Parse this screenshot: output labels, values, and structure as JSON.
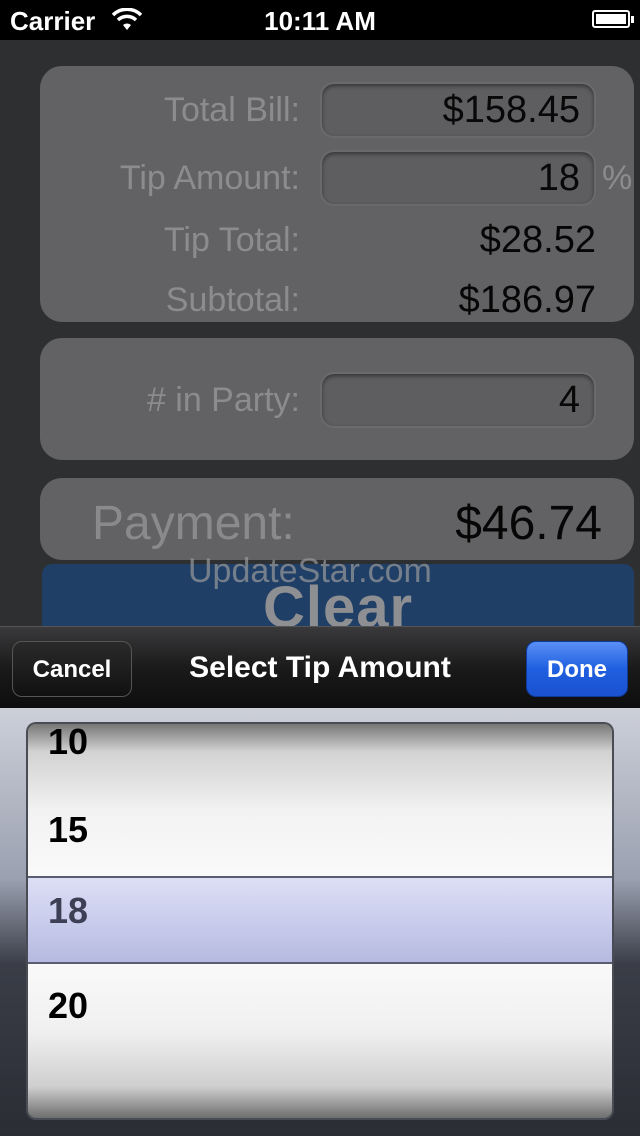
{
  "status_bar": {
    "carrier": "Carrier",
    "time": "10:11 AM"
  },
  "calculator": {
    "total_bill_label": "Total Bill:",
    "total_bill_value": "$158.45",
    "tip_amount_label": "Tip Amount:",
    "tip_amount_value": "18",
    "tip_amount_unit": "%",
    "tip_total_label": "Tip Total:",
    "tip_total_value": "$28.52",
    "subtotal_label": "Subtotal:",
    "subtotal_value": "$186.97",
    "party_label": "# in Party:",
    "party_value": "4",
    "payment_label": "Payment:",
    "payment_value": "$46.74",
    "clear_label": "Clear"
  },
  "watermark": "UpdateStar.com",
  "picker_toolbar": {
    "cancel_label": "Cancel",
    "title": "Select Tip Amount",
    "done_label": "Done"
  },
  "picker": {
    "options": [
      "10",
      "15",
      "18",
      "20"
    ],
    "selected": "18"
  },
  "colors": {
    "done_button": "#1f5fe0",
    "clear_button": "#203f66"
  }
}
